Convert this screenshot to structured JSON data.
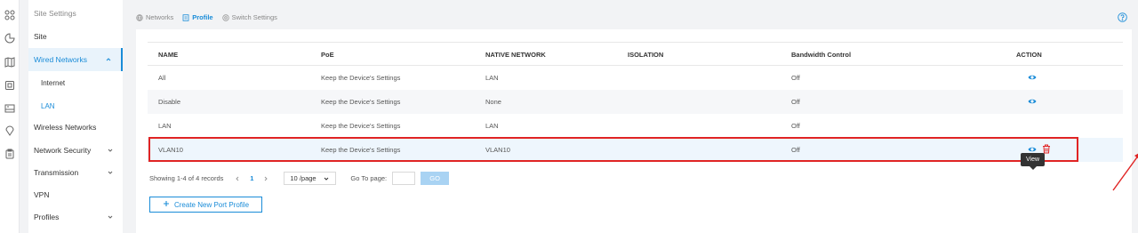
{
  "iconbar": {
    "icons": [
      "apps-icon",
      "chart-icon",
      "map-icon",
      "device-icon",
      "gateway-icon",
      "location-icon",
      "clipboard-icon"
    ]
  },
  "sidebar": {
    "items": [
      {
        "label": "Site Settings"
      },
      {
        "label": "Site"
      },
      {
        "label": "Wired Networks"
      },
      {
        "label": "Internet"
      },
      {
        "label": "LAN"
      },
      {
        "label": "Wireless Networks"
      },
      {
        "label": "Network Security"
      },
      {
        "label": "Transmission"
      },
      {
        "label": "VPN"
      },
      {
        "label": "Profiles"
      }
    ]
  },
  "tabs": [
    {
      "label": "Networks",
      "icon": "network-icon"
    },
    {
      "label": "Profile",
      "icon": "profile-icon"
    },
    {
      "label": "Switch Settings",
      "icon": "switch-settings-icon"
    }
  ],
  "table": {
    "columns": [
      "NAME",
      "PoE",
      "NATIVE NETWORK",
      "ISOLATION",
      "Bandwidth Control",
      "ACTION"
    ],
    "rows": [
      {
        "name": "All",
        "poe": "Keep the Device's Settings",
        "native": "LAN",
        "isolation": "",
        "bandwidth": "Off"
      },
      {
        "name": "Disable",
        "poe": "Keep the Device's Settings",
        "native": "None",
        "isolation": "",
        "bandwidth": "Off"
      },
      {
        "name": "LAN",
        "poe": "Keep the Device's Settings",
        "native": "LAN",
        "isolation": "",
        "bandwidth": "Off"
      },
      {
        "name": "VLAN10",
        "poe": "Keep the Device's Settings",
        "native": "VLAN10",
        "isolation": "",
        "bandwidth": "Off"
      }
    ]
  },
  "tooltip": {
    "text": "View"
  },
  "pagination": {
    "summary": "Showing 1-4 of 4 records",
    "current_page": "1",
    "per_page": "10 /page",
    "goto_label": "Go To page:",
    "go_label": "GO"
  },
  "create_button": {
    "label": "Create New Port Profile"
  },
  "colors": {
    "accent": "#1a8cd8",
    "highlight_border": "#e02424",
    "delete": "#e02424"
  }
}
